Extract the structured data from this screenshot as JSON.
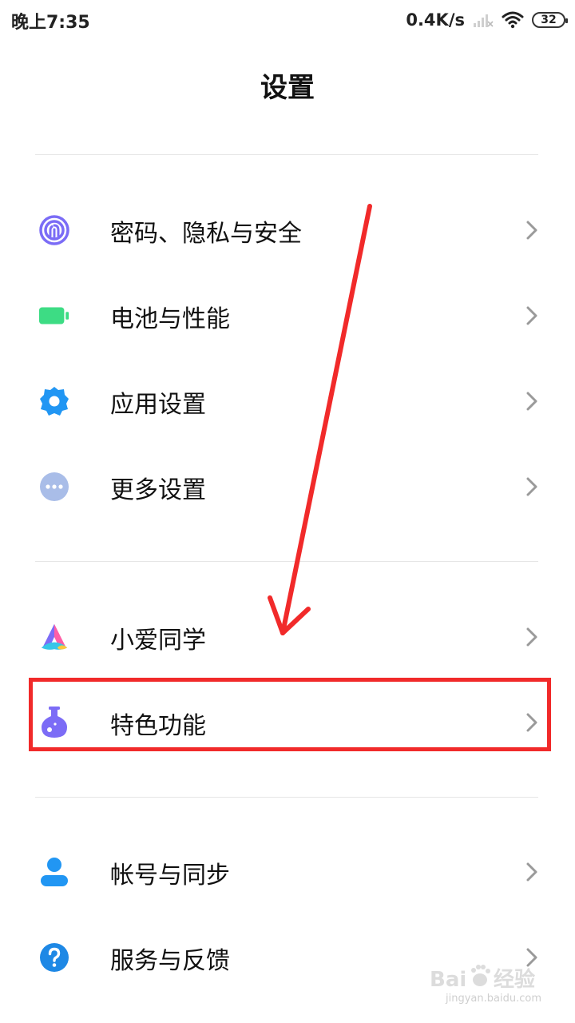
{
  "status_bar": {
    "time": "晚上7:35",
    "network_speed": "0.4K/s",
    "battery_level": "32"
  },
  "header": {
    "title": "设置"
  },
  "sections": [
    {
      "items": [
        {
          "label": "密码、隐私与安全",
          "icon": "fingerprint-icon",
          "color": "#7b6cf6"
        },
        {
          "label": "电池与性能",
          "icon": "battery-icon",
          "color": "#3ddc84"
        },
        {
          "label": "应用设置",
          "icon": "gear-icon",
          "color": "#2196f3"
        },
        {
          "label": "更多设置",
          "icon": "more-icon",
          "color": "#a9bde8"
        }
      ]
    },
    {
      "items": [
        {
          "label": "小爱同学",
          "icon": "xiaoai-icon",
          "color": "#ff5ea6"
        },
        {
          "label": "特色功能",
          "icon": "flask-icon",
          "color": "#7c6cf6"
        }
      ]
    },
    {
      "items": [
        {
          "label": "帐号与同步",
          "icon": "account-icon",
          "color": "#2196f3"
        },
        {
          "label": "服务与反馈",
          "icon": "help-icon",
          "color": "#1e88e5"
        }
      ]
    }
  ],
  "annotation": {
    "highlight_color": "#f12a2a"
  },
  "watermark": {
    "logo_text": "Bai 经验",
    "url": "jingyan.baidu.com"
  }
}
